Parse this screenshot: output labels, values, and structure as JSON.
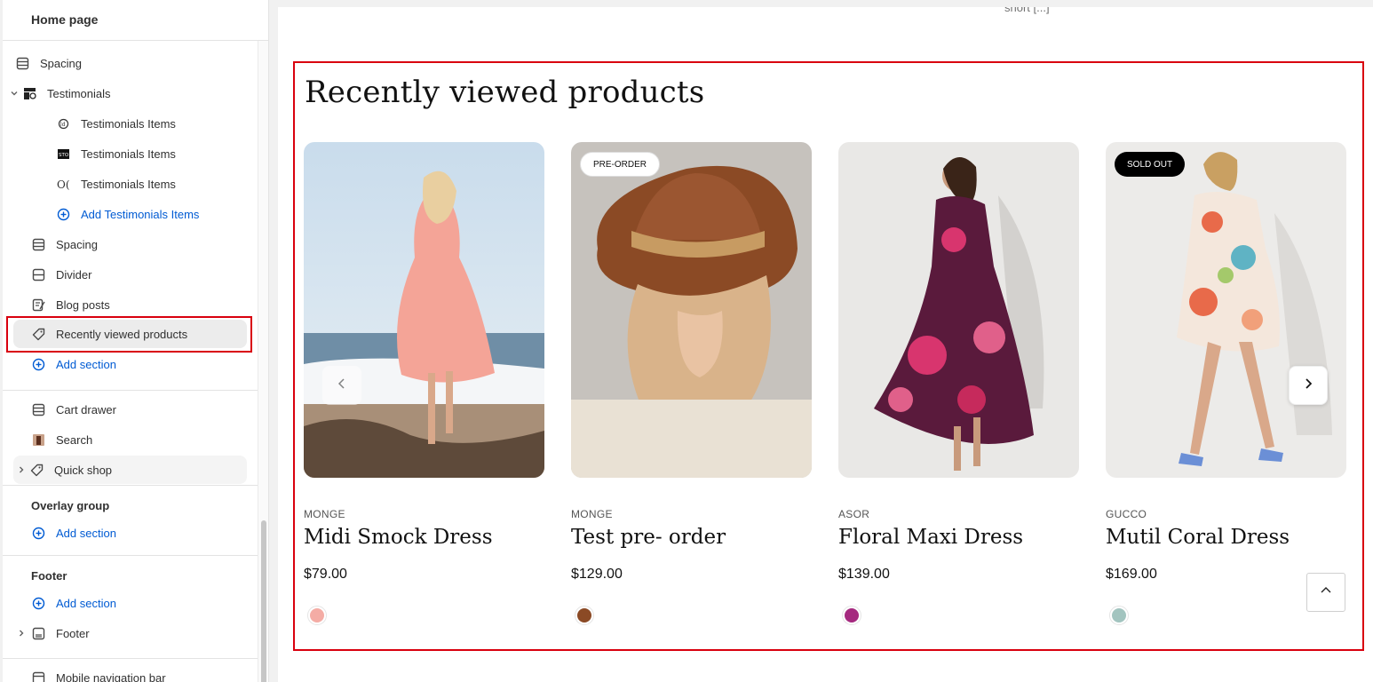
{
  "sidebar": {
    "header": "Home page",
    "items": [
      {
        "label": "Spacing",
        "icon": "spacing-icon"
      },
      {
        "label": "Testimonials",
        "icon": "testimonials-icon",
        "expanded": true
      },
      {
        "label": "Testimonials Items",
        "icon": "testimonial-item-icon"
      },
      {
        "label": "Testimonials Items",
        "icon": "testimonial-item-icon"
      },
      {
        "label": "Testimonials Items",
        "icon": "testimonial-item-icon"
      },
      {
        "label": "Add Testimonials Items",
        "icon": "add-circle-icon"
      },
      {
        "label": "Spacing",
        "icon": "spacing-icon"
      },
      {
        "label": "Divider",
        "icon": "divider-icon"
      },
      {
        "label": "Blog posts",
        "icon": "blog-icon"
      },
      {
        "label": "Recently viewed products",
        "icon": "tag-icon",
        "selected": true
      },
      {
        "label": "Add section",
        "icon": "add-circle-icon"
      }
    ],
    "footer_items": [
      {
        "label": "Cart drawer",
        "icon": "section-icon"
      },
      {
        "label": "Search",
        "icon": "image-thumb-icon"
      },
      {
        "label": "Quick shop",
        "icon": "tag-icon"
      }
    ],
    "overlay_group": {
      "label": "Overlay group",
      "add_label": "Add section"
    },
    "footer_group": {
      "label": "Footer",
      "add_label": "Add section",
      "item_label": "Footer"
    },
    "last_item": "Mobile navigation bar"
  },
  "preview": {
    "cutoff_text": "short [...]",
    "section_title": "Recently viewed products",
    "products": [
      {
        "vendor": "MONGE",
        "name": "Midi Smock Dress",
        "price": "$79.00",
        "badge": "",
        "swatch": "#f4aca5"
      },
      {
        "vendor": "MONGE",
        "name": "Test pre- order",
        "price": "$129.00",
        "badge": "PRE-ORDER",
        "swatch": "#8b4a25"
      },
      {
        "vendor": "ASOR",
        "name": "Floral Maxi Dress",
        "price": "$139.00",
        "badge": "",
        "swatch": "#a5297f"
      },
      {
        "vendor": "GUCCO",
        "name": "Mutil Coral Dress",
        "price": "$169.00",
        "badge": "SOLD OUT",
        "swatch": "#a2c4bf"
      }
    ]
  },
  "colors": {
    "accent_blue": "#005bd3",
    "highlight_red": "#d9000e"
  }
}
